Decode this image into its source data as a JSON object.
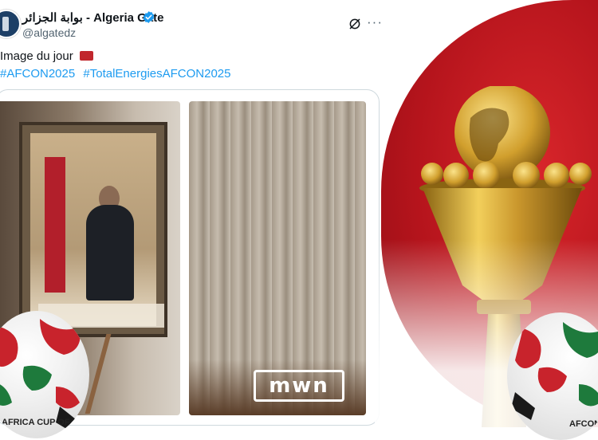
{
  "tweet": {
    "display_name": "بوابة الجزائر - Algeria Gate",
    "handle": "@algatedz",
    "text": "Image du jour",
    "hashtags": [
      "#AFCON2025",
      "#TotalEnergiesAFCON2025"
    ]
  },
  "icons": {
    "verified": "verified-badge-icon",
    "grok": "grok-icon",
    "more": "more-options-icon",
    "flag": "morocco-flag-emoji"
  },
  "overlay": {
    "watermark": "mwn",
    "ball_left_text": "AFRICA CUP OF NATIONS",
    "ball_right_text": "AFCON"
  },
  "colors": {
    "link": "#1d9bf0",
    "verified": "#1d9bf0",
    "background_red": "#c41e26",
    "gold": "#d4a53a"
  }
}
